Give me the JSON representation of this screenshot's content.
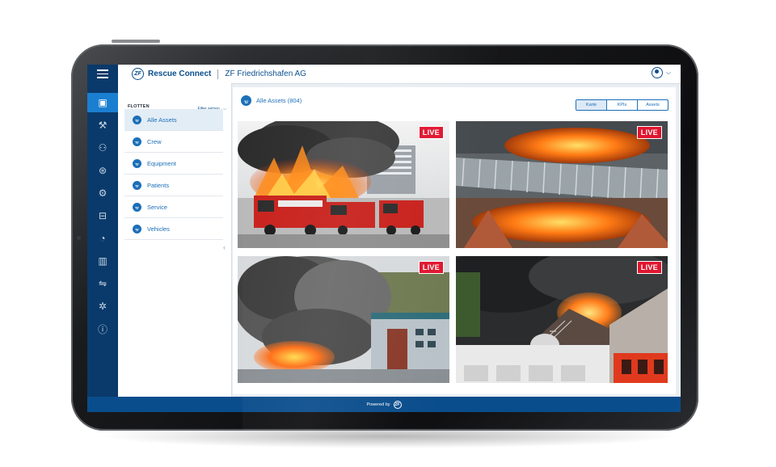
{
  "app": {
    "logo_text": "ZF",
    "name": "Rescue Connect",
    "company": "ZF Friedrichshafen AG"
  },
  "rail_icons": [
    {
      "name": "dashboard-icon",
      "glyph": "▣",
      "active": true
    },
    {
      "name": "tools-icon",
      "glyph": "⚒",
      "active": false
    },
    {
      "name": "crew-icon",
      "glyph": "⚇",
      "active": false
    },
    {
      "name": "coin-icon",
      "glyph": "⊛",
      "active": false
    },
    {
      "name": "asset-search-icon",
      "glyph": "⚙",
      "active": false
    },
    {
      "name": "monitor-icon",
      "glyph": "⊟",
      "active": false
    },
    {
      "name": "gauge-icon",
      "glyph": "◔",
      "active": false
    },
    {
      "name": "statistics-icon",
      "glyph": "▥",
      "active": false
    },
    {
      "name": "handshake-icon",
      "glyph": "⇋",
      "active": false
    },
    {
      "name": "settings-icon",
      "glyph": "✲",
      "active": false
    },
    {
      "name": "info-icon",
      "glyph": "ⓘ",
      "active": false
    }
  ],
  "panel": {
    "title": "FLOTTEN",
    "filter": "Filter setzen",
    "items": [
      {
        "label": "Alle Assets",
        "active": true
      },
      {
        "label": "Crew",
        "active": false
      },
      {
        "label": "Equipment",
        "active": false
      },
      {
        "label": "Patients",
        "active": false
      },
      {
        "label": "Service",
        "active": false
      },
      {
        "label": "Vehicles",
        "active": false
      }
    ]
  },
  "main": {
    "title": "Alle Assets (804)",
    "views": [
      {
        "label": "Karte",
        "active": true
      },
      {
        "label": "KPIs",
        "active": false
      },
      {
        "label": "Assets",
        "active": false
      }
    ],
    "live_label": "LIVE"
  },
  "footer": {
    "text": "Powered by",
    "logo_text": "ZF"
  },
  "colors": {
    "navy": "#0a3a6b",
    "primary": "#1b6fb8",
    "live_red": "#e0152f"
  }
}
